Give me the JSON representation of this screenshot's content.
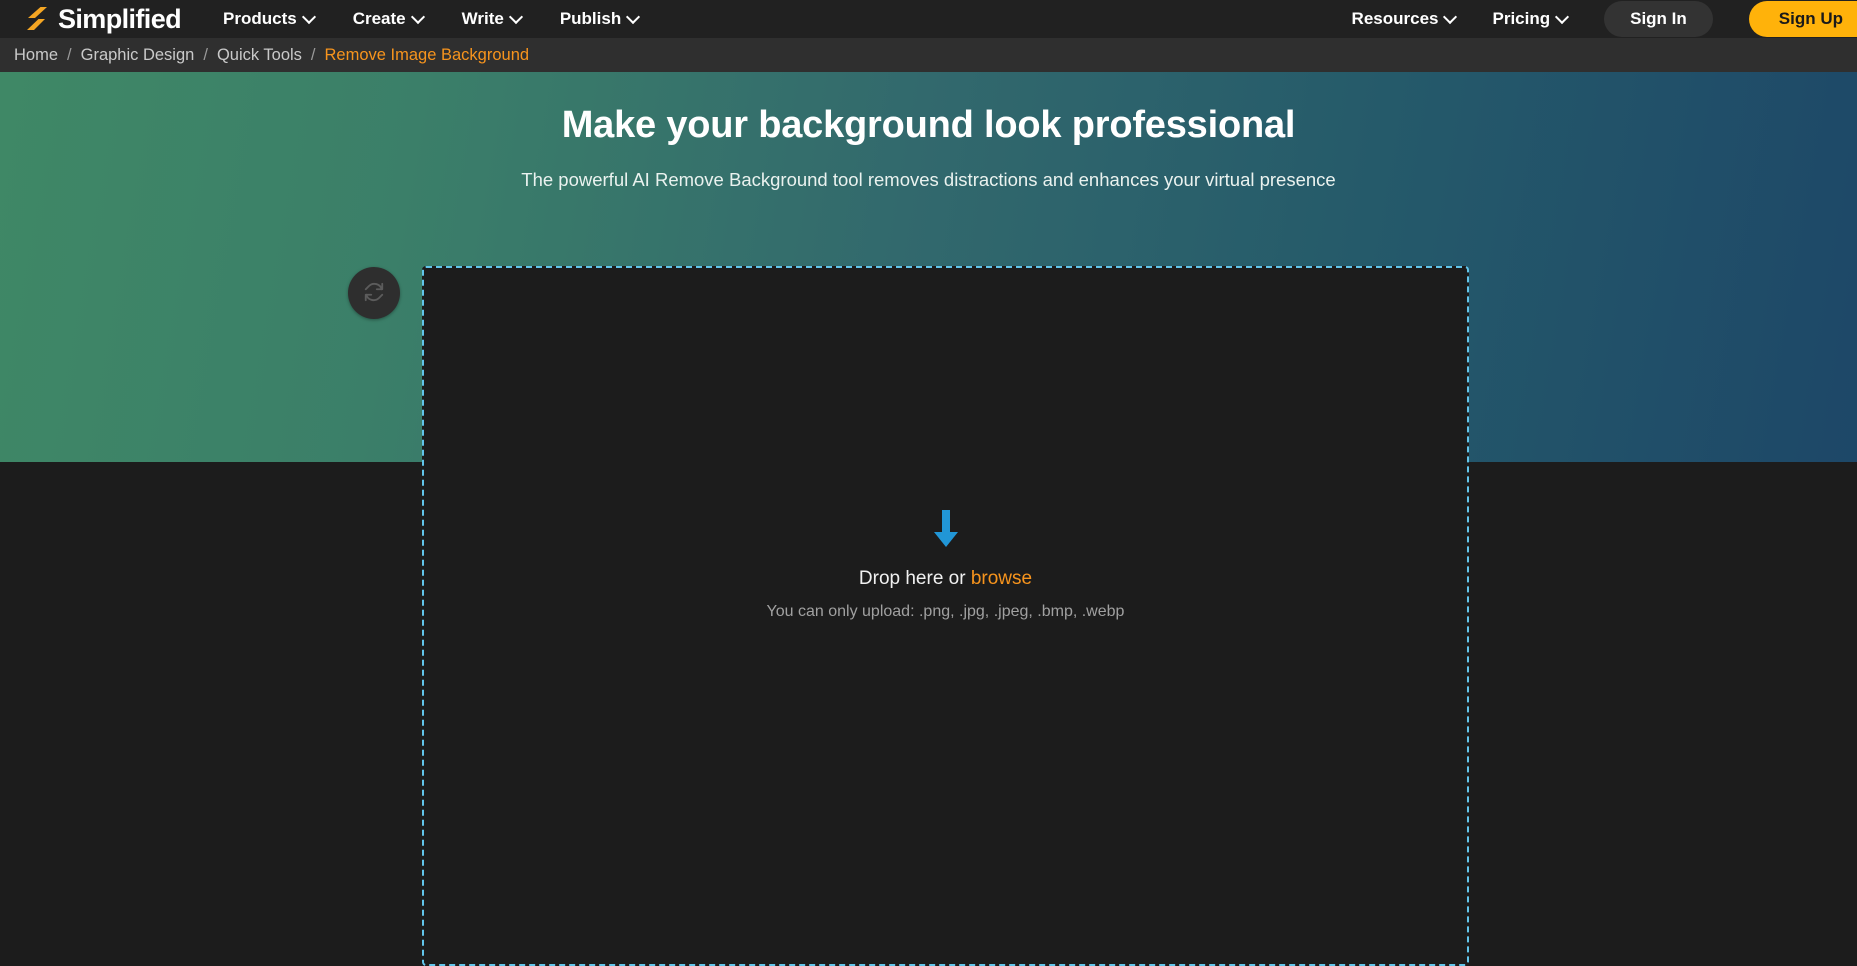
{
  "navbar": {
    "brand": {
      "name": "Simplified",
      "logo_icon": "simplified-s-logo",
      "logo_color": "#f5a623"
    },
    "links": [
      {
        "label": "Products",
        "icon": "chevron-down-icon"
      },
      {
        "label": "Create",
        "icon": "chevron-down-icon"
      },
      {
        "label": "Write",
        "icon": "chevron-down-icon"
      },
      {
        "label": "Publish",
        "icon": "chevron-down-icon"
      }
    ],
    "right_links": [
      {
        "label": "Resources",
        "icon": "chevron-down-icon"
      },
      {
        "label": "Pricing",
        "icon": "chevron-down-icon"
      }
    ],
    "sign_in_label": "Sign In",
    "sign_up_label": "Sign Up",
    "sign_up_color": "#ffb20a",
    "background": "#212121"
  },
  "breadcrumb": {
    "separator": "/",
    "items": [
      {
        "label": "Home",
        "active": false
      },
      {
        "label": "Graphic Design",
        "active": false
      },
      {
        "label": "Quick Tools",
        "active": false
      },
      {
        "label": "Remove Image Background",
        "active": true
      }
    ],
    "active_color": "#f7941d",
    "background": "#2f2f2f"
  },
  "hero": {
    "title": "Make your background look professional",
    "subtitle": "The powerful AI Remove Background tool removes distractions and enhances your virtual presence",
    "gradient_from": "#3f8866",
    "gradient_to": "#1d4768"
  },
  "tool": {
    "reset_button": {
      "icon": "refresh-icon",
      "label": ""
    },
    "dropzone": {
      "arrow_icon": "download-arrow-icon",
      "arrow_color": "#2196d6",
      "prompt_prefix": "Drop here or ",
      "browse_label": "browse",
      "hint": "You can only upload: .png, .jpg, .jpeg, .bmp, .webp",
      "border_color": "#62c5ea",
      "background": "#1c1c1c"
    }
  }
}
